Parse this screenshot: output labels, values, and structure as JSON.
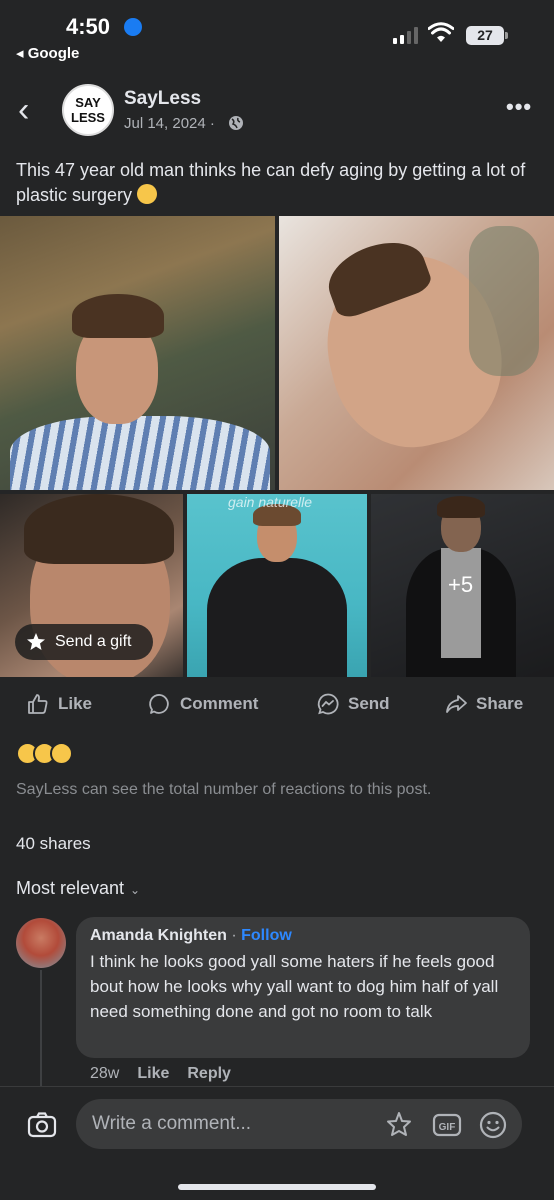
{
  "status_bar": {
    "time": "4:50",
    "back_app": "◂ Google",
    "battery": "27"
  },
  "post": {
    "page_name": "SayLess",
    "date": "Jul 14, 2024 ·",
    "avatar_text": "SAY LESS",
    "text": "This 47 year old man thinks he can defy aging by getting a lot of plastic surgery",
    "more_photos": "+5",
    "brand_watermark": "gain naturelle",
    "gift_label": "Send a gift"
  },
  "actions": {
    "like": "Like",
    "comment": "Comment",
    "send": "Send",
    "share": "Share"
  },
  "reactions": {
    "icons": [
      "surprised-face",
      "surprised-face",
      "sad-face"
    ],
    "note": "SayLess can see the total number of reactions to this post."
  },
  "shares": "40 shares",
  "sort_label": "Most relevant",
  "comments": [
    {
      "author": "Amanda Knighten",
      "follow": "Follow",
      "text": "I think he looks good yall some haters if he feels good bout how he looks why yall want to dog him half of yall need something done and got no room to talk",
      "age": "28w",
      "like": "Like",
      "reply": "Reply"
    }
  ],
  "composer": {
    "placeholder": "Write a comment..."
  },
  "colors": {
    "background": "#242526",
    "bubble": "#3a3b3c",
    "link": "#2d88ff",
    "muted": "#b0b3b8"
  }
}
